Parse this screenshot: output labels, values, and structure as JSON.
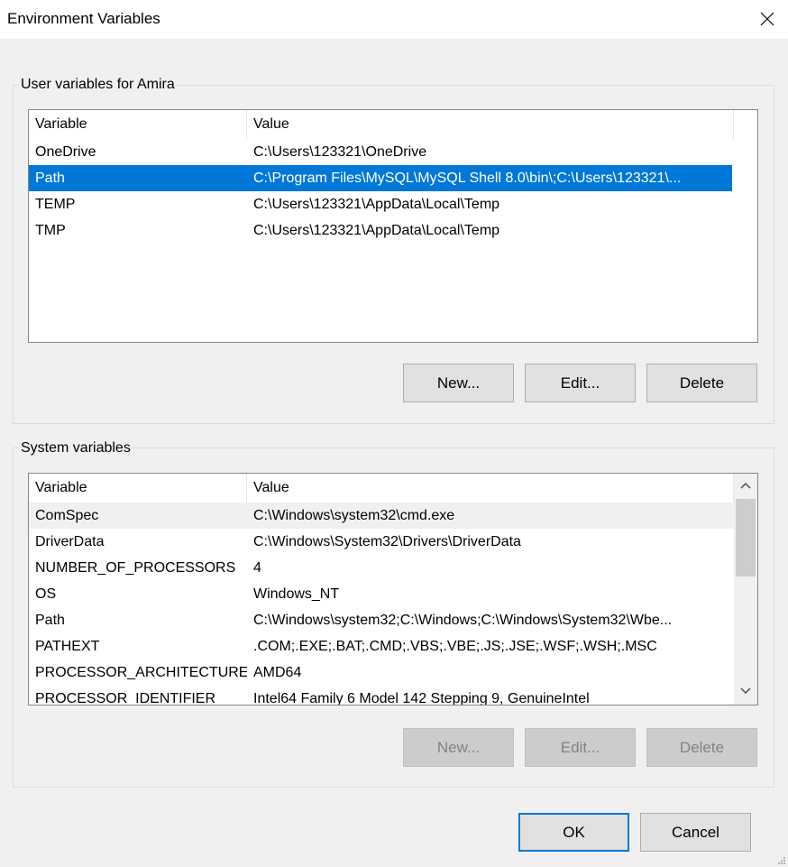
{
  "window": {
    "title": "Environment Variables",
    "close_icon": "close-icon"
  },
  "user_vars": {
    "group_label": "User variables for Amira",
    "columns": [
      "Variable",
      "Value"
    ],
    "rows": [
      {
        "variable": "OneDrive",
        "value": "C:\\Users\\123321\\OneDrive"
      },
      {
        "variable": "Path",
        "value": "C:\\Program Files\\MySQL\\MySQL Shell 8.0\\bin\\;C:\\Users\\123321\\...",
        "selected": true
      },
      {
        "variable": "TEMP",
        "value": "C:\\Users\\123321\\AppData\\Local\\Temp"
      },
      {
        "variable": "TMP",
        "value": "C:\\Users\\123321\\AppData\\Local\\Temp"
      }
    ],
    "buttons": {
      "new": "New...",
      "edit": "Edit...",
      "delete": "Delete"
    }
  },
  "system_vars": {
    "group_label": "System variables",
    "columns": [
      "Variable",
      "Value"
    ],
    "rows": [
      {
        "variable": "ComSpec",
        "value": "C:\\Windows\\system32\\cmd.exe",
        "hover": true
      },
      {
        "variable": "DriverData",
        "value": "C:\\Windows\\System32\\Drivers\\DriverData"
      },
      {
        "variable": "NUMBER_OF_PROCESSORS",
        "value": "4"
      },
      {
        "variable": "OS",
        "value": "Windows_NT"
      },
      {
        "variable": "Path",
        "value": "C:\\Windows\\system32;C:\\Windows;C:\\Windows\\System32\\Wbe..."
      },
      {
        "variable": "PATHEXT",
        "value": ".COM;.EXE;.BAT;.CMD;.VBS;.VBE;.JS;.JSE;.WSF;.WSH;.MSC"
      },
      {
        "variable": "PROCESSOR_ARCHITECTURE",
        "value": "AMD64"
      },
      {
        "variable": "PROCESSOR_IDENTIFIER",
        "value": "Intel64 Family 6 Model 142 Stepping 9, GenuineIntel"
      }
    ],
    "buttons": {
      "new": "New...",
      "edit": "Edit...",
      "delete": "Delete"
    },
    "buttons_disabled": true
  },
  "footer": {
    "ok": "OK",
    "cancel": "Cancel"
  },
  "colors": {
    "selection": "#0078d7",
    "default_button_border": "#0078d7"
  }
}
